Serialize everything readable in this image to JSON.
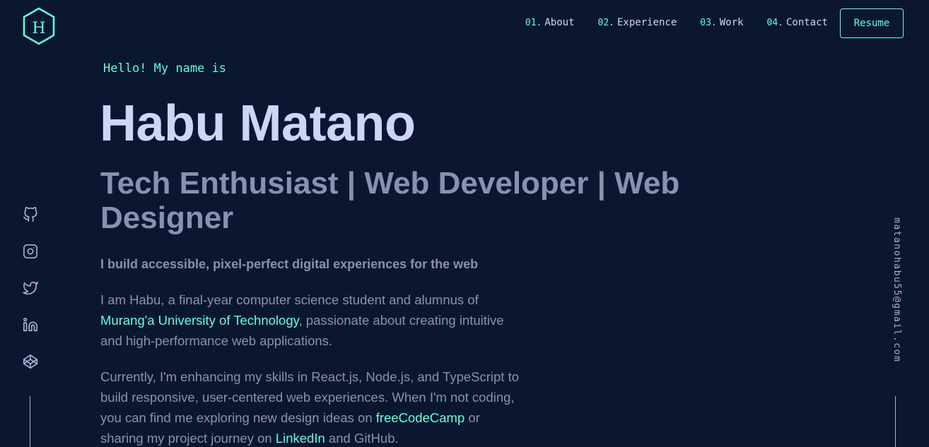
{
  "logo": {
    "letter": "H"
  },
  "nav": [
    {
      "num": "01.",
      "label": "About"
    },
    {
      "num": "02.",
      "label": "Experience"
    },
    {
      "num": "03.",
      "label": "Work"
    },
    {
      "num": "04.",
      "label": "Contact"
    }
  ],
  "resume_label": "Resume",
  "hero": {
    "greeting": "Hello! My name is",
    "name": "Habu Matano",
    "tagline": "Tech Enthusiast | Web Developer | Web Designer",
    "lead": "I build accessible, pixel-perfect digital experiences for the web",
    "p1": {
      "before": "I am Habu, a final-year computer science student and alumnus of ",
      "link": "Murang'a University of Technology",
      "after": ", passionate about creating intuitive and high-performance web applications."
    },
    "p2": {
      "before": "Currently, I'm enhancing my skills in React.js, Node.js, and TypeScript to build responsive, user-centered web experiences. When I'm not coding, you can find me exploring new design ideas on ",
      "link1": "freeCodeCamp",
      "middle": " or sharing my project journey on ",
      "link2": "LinkedIn",
      "after": " and GitHub."
    }
  },
  "social_icons": [
    "github-icon",
    "instagram-icon",
    "twitter-icon",
    "linkedin-icon",
    "codepen-icon"
  ],
  "email": "matanohabu55@gmail.com",
  "colors": {
    "background": "#0b1730",
    "accent": "#64ffda",
    "heading": "#ccd6f6",
    "body": "#8892b0"
  }
}
